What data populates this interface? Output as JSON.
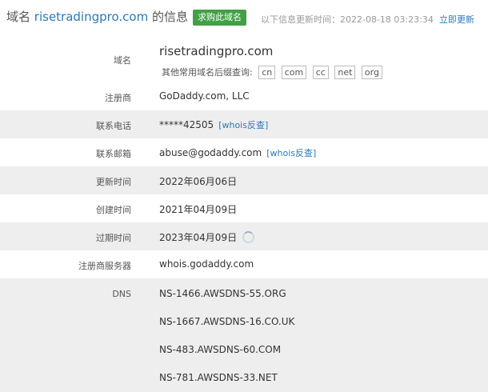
{
  "header": {
    "title_prefix": "域名",
    "domain": "risetradingpro.com",
    "title_suffix": "的信息",
    "buy_button": "求购此域名",
    "update_label": "以下信息更新时间：2022-08-18 03:23:34",
    "update_link": "立即更新"
  },
  "rows": {
    "domain": {
      "label": "域名",
      "value": "risetradingpro.com",
      "suffix_label": "其他常用域名后缀查询:",
      "suffixes": [
        "cn",
        "com",
        "cc",
        "net",
        "org"
      ]
    },
    "registrar": {
      "label": "注册商",
      "value": "GoDaddy.com, LLC"
    },
    "phone": {
      "label": "联系电话",
      "value": "*****42505",
      "link": "[whois反查]"
    },
    "email": {
      "label": "联系邮箱",
      "value": "abuse@godaddy.com",
      "link": "[whois反查]"
    },
    "updated": {
      "label": "更新时间",
      "value": "2022年06月06日"
    },
    "created": {
      "label": "创建时间",
      "value": "2021年04月09日"
    },
    "expires": {
      "label": "过期时间",
      "value": "2023年04月09日"
    },
    "whois_server": {
      "label": "注册商服务器",
      "value": "whois.godaddy.com"
    },
    "dns": {
      "label": "DNS",
      "values": [
        "NS-1466.AWSDNS-55.ORG",
        "NS-1667.AWSDNS-16.CO.UK",
        "NS-483.AWSDNS-60.COM",
        "NS-781.AWSDNS-33.NET"
      ]
    }
  },
  "colors": {
    "link": "#2a7ab8",
    "buy_button": "#43a047",
    "shaded_row": "#eeeeee"
  }
}
